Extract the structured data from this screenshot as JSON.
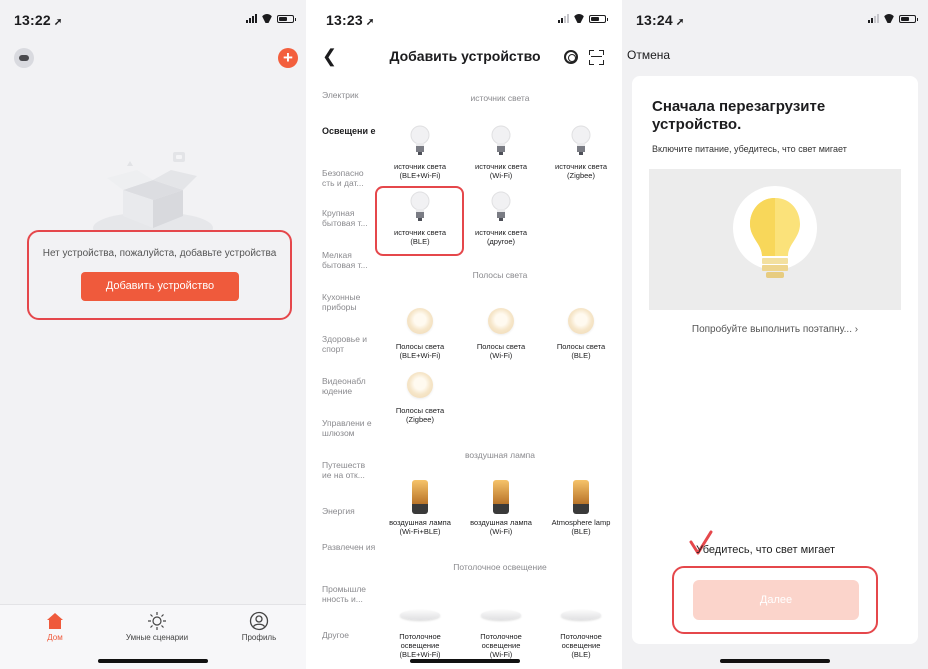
{
  "screens": [
    {
      "time": "13:22",
      "empty_message": "Нет устройства, пожалуйста, добавьте устройства",
      "add_device_button": "Добавить устройство",
      "tabs": [
        {
          "label": "Дом",
          "icon": "home-icon",
          "active": true
        },
        {
          "label": "Умные сценарии",
          "icon": "sun-icon",
          "active": false
        },
        {
          "label": "Профиль",
          "icon": "profile-icon",
          "active": false
        }
      ]
    },
    {
      "time": "13:23",
      "title": "Добавить устройство",
      "categories": [
        "Электрик",
        "Освещени е",
        "Безопасно сть и дат...",
        "Крупная бытовая т...",
        "Мелкая бытовая т...",
        "Кухонные приборы",
        "Здоровье и спорт",
        "Видеонабл юдение",
        "Управлени е шлюзом",
        "Путешеств ие на отк...",
        "Энергия",
        "Развлечен ия",
        "Промышле нность и...",
        "Другое"
      ],
      "sections": {
        "light": {
          "title": "источник света",
          "items": [
            {
              "l1": "источник света",
              "l2": "(BLE+Wi-Fi)"
            },
            {
              "l1": "источник света",
              "l2": "(Wi-Fi)"
            },
            {
              "l1": "источник света",
              "l2": "(Zigbee)"
            },
            {
              "l1": "источник света",
              "l2": "(BLE)"
            },
            {
              "l1": "источник света",
              "l2": "(другое)"
            }
          ]
        },
        "strips": {
          "title": "Полосы света",
          "items": [
            {
              "l1": "Полосы света",
              "l2": "(BLE+Wi-Fi)"
            },
            {
              "l1": "Полосы света",
              "l2": "(Wi-Fi)"
            },
            {
              "l1": "Полосы света",
              "l2": "(BLE)"
            },
            {
              "l1": "Полосы света",
              "l2": "(Zigbee)"
            }
          ]
        },
        "air": {
          "title": "воздушная лампа",
          "items": [
            {
              "l1": "воздушная лампа",
              "l2": "(Wi-Fi+BLE)"
            },
            {
              "l1": "воздушная лампа",
              "l2": "(Wi-Fi)"
            },
            {
              "l1": "Atmosphere lamp",
              "l2": "(BLE)"
            }
          ]
        },
        "ceiling": {
          "title": "Потолочное освещение",
          "items": [
            {
              "l1": "Потолочное",
              "l2": "освещение",
              "l3": "(BLE+Wi-Fi)"
            },
            {
              "l1": "Потолочное",
              "l2": "освещение",
              "l3": "(Wi-Fi)"
            },
            {
              "l1": "Потолочное",
              "l2": "освещение",
              "l3": "(BLE)"
            }
          ]
        }
      }
    },
    {
      "time": "13:24",
      "cancel": "Отмена",
      "title": "Сначала перезагрузите устройство.",
      "subtitle": "Включите питание, убедитесь, что свет мигает",
      "step_link": "Попробуйте выполнить поэтапну...",
      "confirm": "Убедитесь, что свет мигает",
      "next_button": "Далее"
    }
  ],
  "colors": {
    "accent": "#ef5a3c",
    "highlight": "#e5474b",
    "next_disabled": "#fbd4cb"
  }
}
